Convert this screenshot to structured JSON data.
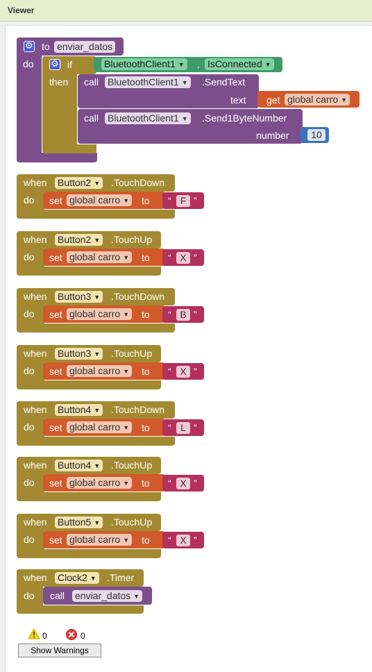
{
  "viewer": {
    "title": "Viewer"
  },
  "procedure": {
    "to_label": "to",
    "name": "enviar_datos",
    "do_label": "do",
    "if_label": "if",
    "then_label": "then",
    "condition_component": "BluetoothClient1",
    "condition_dot": ".",
    "condition_property": "IsConnected",
    "call_label": "call",
    "call1_component": "BluetoothClient1",
    "call1_method": ".SendText",
    "call1_arg_label": "text",
    "get_label": "get",
    "get_var": "global carro",
    "call2_component": "BluetoothClient1",
    "call2_method": ".Send1ByteNumber",
    "call2_arg_label": "number",
    "number_value": "10"
  },
  "events": [
    {
      "when": "when",
      "component": "Button2",
      "event": ".TouchDown",
      "do": "do",
      "set": "set",
      "var": "global carro",
      "to": "to",
      "value": "F"
    },
    {
      "when": "when",
      "component": "Button2",
      "event": ".TouchUp",
      "do": "do",
      "set": "set",
      "var": "global carro",
      "to": "to",
      "value": "X"
    },
    {
      "when": "when",
      "component": "Button3",
      "event": ".TouchDown",
      "do": "do",
      "set": "set",
      "var": "global carro",
      "to": "to",
      "value": "B"
    },
    {
      "when": "when",
      "component": "Button3",
      "event": ".TouchUp",
      "do": "do",
      "set": "set",
      "var": "global carro",
      "to": "to",
      "value": "X"
    },
    {
      "when": "when",
      "component": "Button4",
      "event": ".TouchDown",
      "do": "do",
      "set": "set",
      "var": "global carro",
      "to": "to",
      "value": "L"
    },
    {
      "when": "when",
      "component": "Button4",
      "event": ".TouchUp",
      "do": "do",
      "set": "set",
      "var": "global carro",
      "to": "to",
      "value": "X"
    },
    {
      "when": "when",
      "component": "Button5",
      "event": ".TouchUp",
      "do": "do",
      "set": "set",
      "var": "global carro",
      "to": "to",
      "value": "X"
    }
  ],
  "timer_event": {
    "when": "when",
    "component": "Clock2",
    "event": ".Timer",
    "do": "do",
    "call": "call",
    "procedure": "enviar_datos"
  },
  "status": {
    "warning_count": "0",
    "error_count": "0",
    "show_warnings_label": "Show Warnings"
  },
  "colors": {
    "procedure": "#7c4f8c",
    "control": "#a38a32",
    "bluetooth": "#3e9b69",
    "variable": "#d25a2a",
    "text": "#b3305c",
    "math": "#3c73bd",
    "component_dropdown": "#7fd19f"
  }
}
